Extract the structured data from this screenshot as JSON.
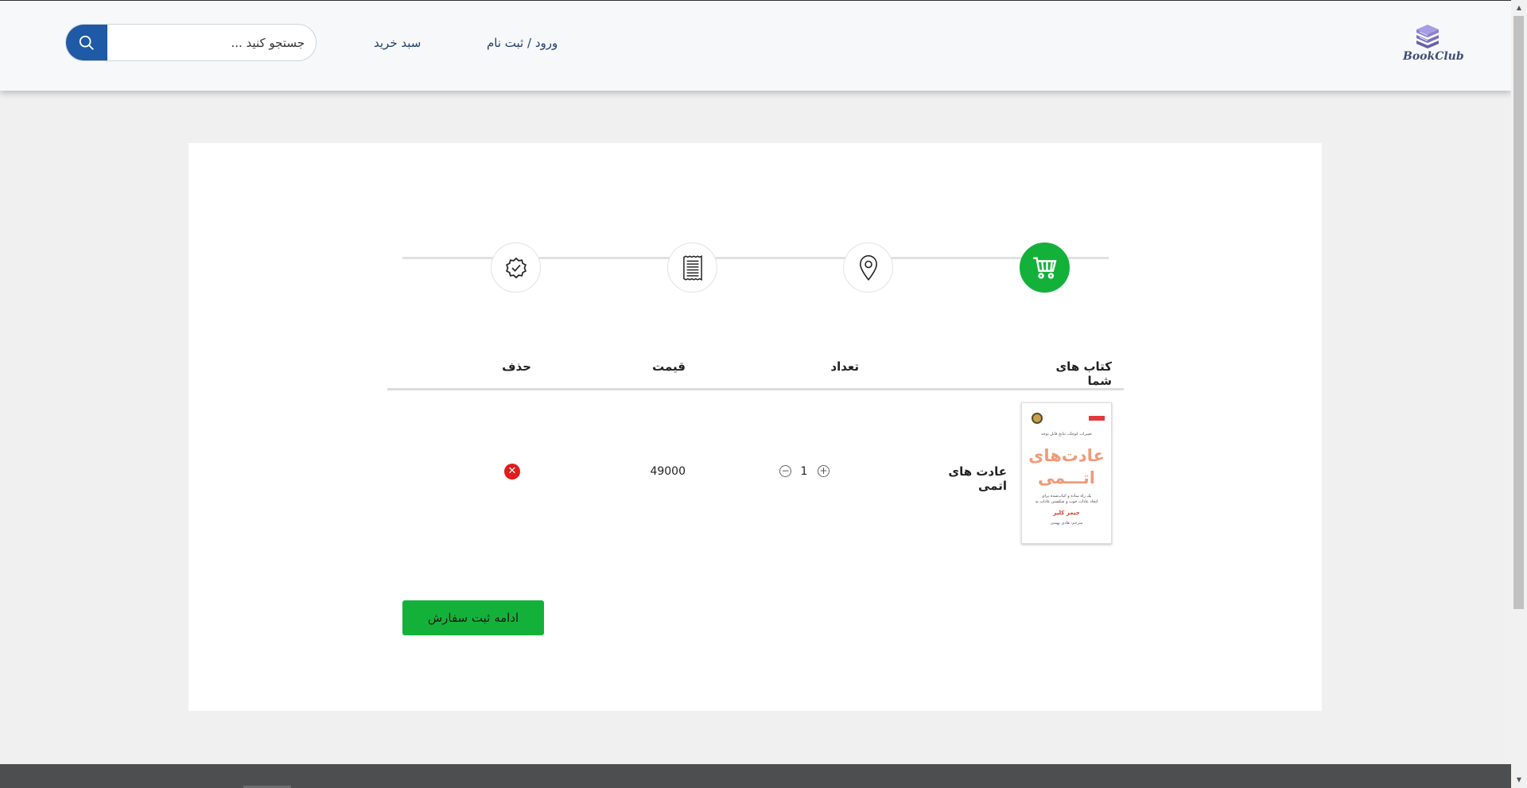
{
  "header": {
    "search_placeholder": "جستجو کنید ...",
    "search_value": "",
    "nav": {
      "cart": "سبد خرید",
      "login": "ورود / ثبت نام"
    },
    "logo_text": "BookClub"
  },
  "steps": [
    {
      "icon": "cart-icon",
      "active": true
    },
    {
      "icon": "location-pin-icon",
      "active": false
    },
    {
      "icon": "invoice-icon",
      "active": false
    },
    {
      "icon": "verified-badge-icon",
      "active": false
    }
  ],
  "table": {
    "headers": {
      "books": "کتاب های شما",
      "qty": "تعداد",
      "price": "قیمت",
      "delete": "حذف"
    },
    "rows": [
      {
        "title": "عادت های اتمی",
        "quantity": "1",
        "price": "49000",
        "cover": {
          "top_line": "تغییرات کوچک، نتایج قابل توجه",
          "title_line1": "عادت‌های",
          "title_line2": "اتـــمی",
          "subtitle_line1": "یک راه ساده و اثبات‌شده برای",
          "subtitle_line2": "ایجاد عادات خوب و شکستن عادات بد",
          "author": "جیمز کلیر",
          "translator": "مترجم: هادی بهمنی"
        }
      }
    ]
  },
  "actions": {
    "continue": "ادامه ثبت سفارش"
  },
  "colors": {
    "primary_blue": "#1e5aa6",
    "success_green": "#14b13a",
    "delete_red": "#e21b1b",
    "footer_gray": "#4d4e50"
  }
}
